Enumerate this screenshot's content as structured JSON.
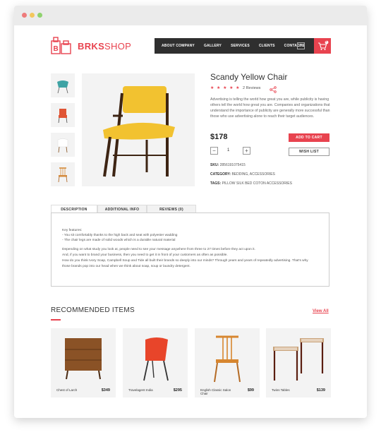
{
  "brand": {
    "name_bold": "BRKS",
    "name_light": "SHOP"
  },
  "nav": {
    "items": [
      "ABOUT COMPANY",
      "GALLERY",
      "SERVICES",
      "CLIENTS",
      "CONTACTS"
    ],
    "lang": "EN",
    "cart_count": "0"
  },
  "product": {
    "title": "Scandy Yellow Chair",
    "stars": "★ ★ ★ ★ ★",
    "reviews": "2 Reviews",
    "description": "Advertising is telling the world how great you are, while publicity is having others tell the world how great you are. Companies and organizations that understand the importance of publicity are generally more successful than those who use advertising alone to reach their target audiences.",
    "price": "$178",
    "add_to_cart": "ADD TO CART",
    "wish_list": "WISH LIST",
    "qty_minus": "−",
    "qty_value": "1",
    "qty_plus": "+",
    "sku_label": "SKU:",
    "sku_value": "2856191075415",
    "category_label": "CATEGORY:",
    "category_value": "BEDDING, ACCESSORIES",
    "tags_label": "TAGS:",
    "tags_value": "PILLOW SILK BED COTON ACCESSORIES"
  },
  "tabs": {
    "items": [
      "DESCRIPTION",
      "ADDITIONAL INFO",
      "REVIEWS (0)"
    ],
    "key_features": "Key features:",
    "feature1": "- You sit comfortably thanks to the high back and seat with polyester wadding",
    "feature2": "- The chair legs are made of solid woods which is a durable natural material",
    "para1": "Depending on what study you look at, people need to see your message anywhere from three to 27 times before they act upon it.",
    "para2": "And, if you want to brand your business, then you need to get it in front of your customers as often as possible.",
    "para3": "How do you think Ivory Soap, Campbell Soup and Tide all built their brands so deeply into our minds? Through years and years of repeatedly advertising. That's why",
    "para4": "those brands pop into our head when we think about soap, soup or laundry detergent."
  },
  "recommended": {
    "title": "RECOMMENDED ITEMS",
    "view_all": "View All",
    "items": [
      {
        "name": "Chest of Larch",
        "price": "$349"
      },
      {
        "name": "Travelagent India",
        "price": "$295"
      },
      {
        "name": "English Classic Salon Chair",
        "price": "$99"
      },
      {
        "name": "Twins Tables",
        "price": "$139"
      }
    ]
  },
  "colors": {
    "accent": "#e8434f",
    "nav_bg": "#2f2f2f",
    "thumb_bg": "#f3f3f3"
  },
  "icons": [
    "cart-icon",
    "share-icon",
    "logo-icon"
  ]
}
